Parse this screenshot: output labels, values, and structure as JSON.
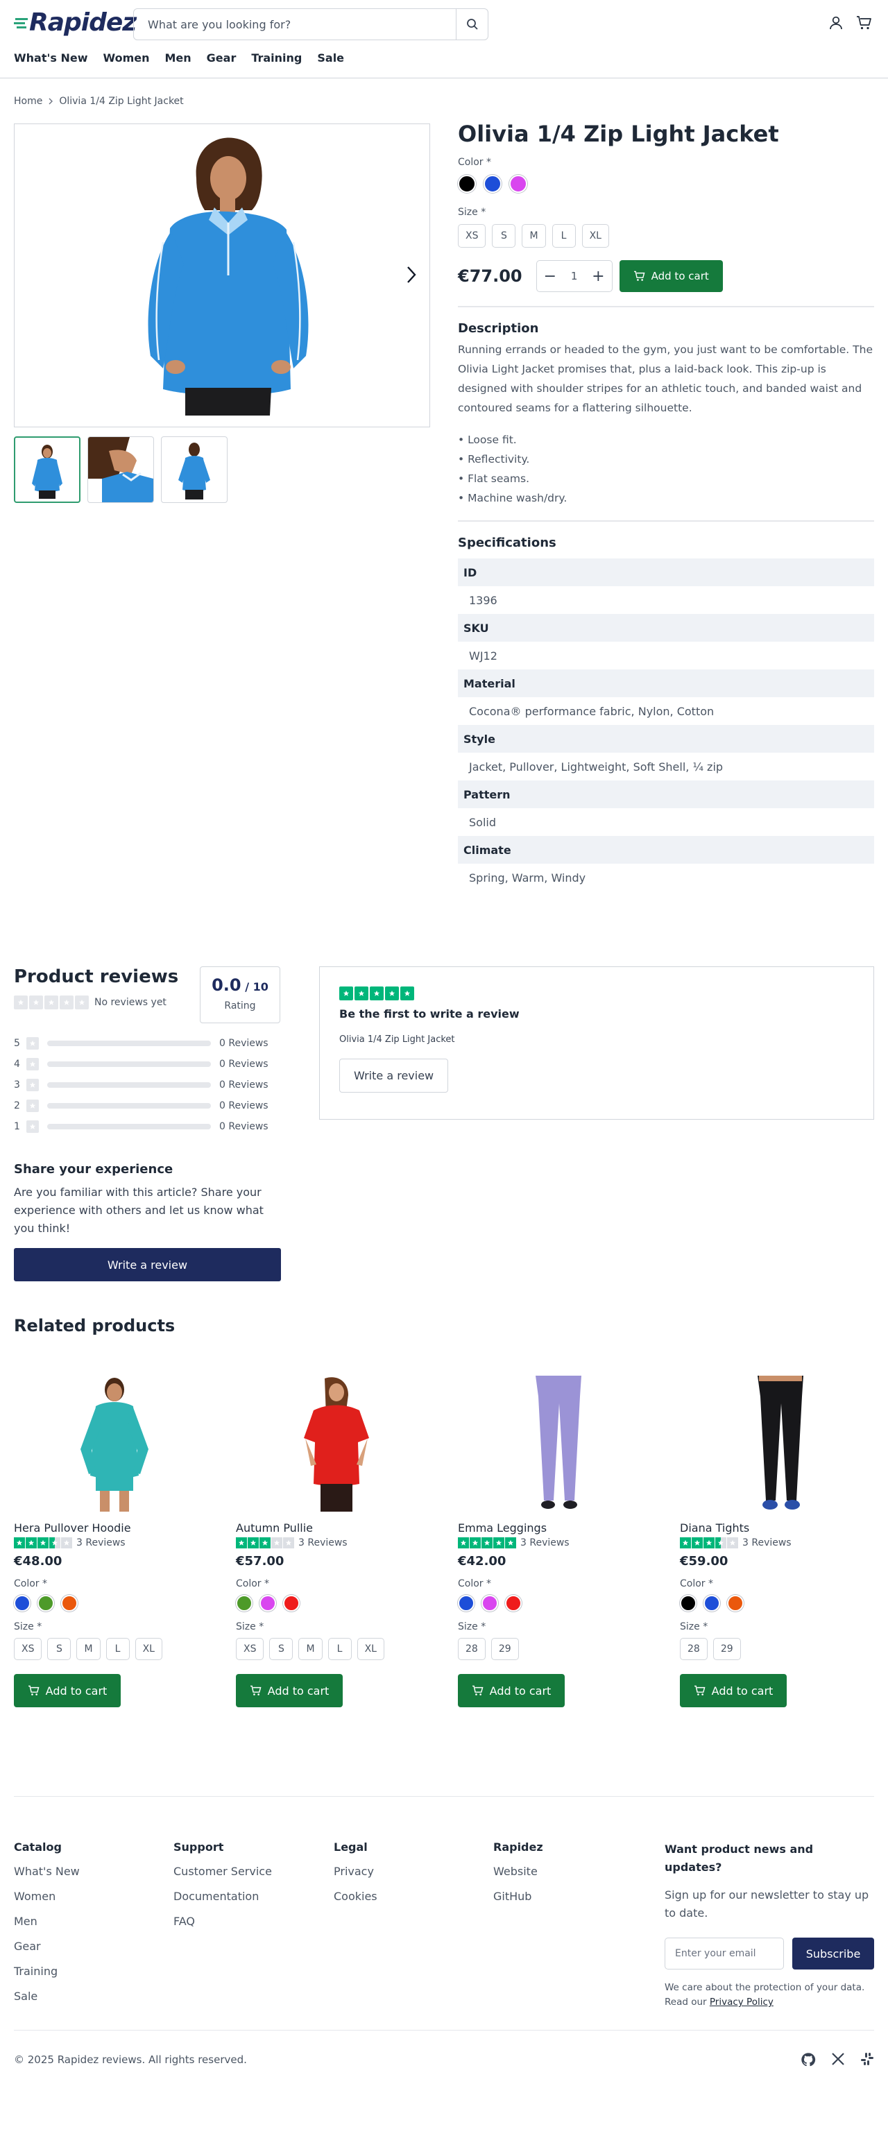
{
  "header": {
    "logo": "Rapidez",
    "search_placeholder": "What are you looking for?",
    "nav": [
      "What's New",
      "Women",
      "Men",
      "Gear",
      "Training",
      "Sale"
    ]
  },
  "breadcrumb": {
    "home": "Home",
    "current": "Olivia 1/4 Zip Light Jacket"
  },
  "product": {
    "title": "Olivia 1/4 Zip Light Jacket",
    "color_label": "Color *",
    "colors": [
      "#000000",
      "#1d4ed8",
      "#d946ef"
    ],
    "size_label": "Size *",
    "sizes": [
      "XS",
      "S",
      "M",
      "L",
      "XL"
    ],
    "price": "€77.00",
    "quantity": "1",
    "add_to_cart": "Add to cart",
    "description_title": "Description",
    "description": "Running errands or headed to the gym, you just want to be comfortable. The Olivia Light Jacket promises that, plus a laid-back look. This zip-up is designed with shoulder stripes for an athletic touch, and banded waist and contoured seams for a flattering silhouette.",
    "bullets": [
      "• Loose fit.",
      "• Reflectivity.",
      "• Flat seams.",
      "• Machine wash/dry."
    ],
    "specs_title": "Specifications",
    "specs": [
      {
        "key": "ID",
        "value": "1396"
      },
      {
        "key": "SKU",
        "value": "WJ12"
      },
      {
        "key": "Material",
        "value": "Cocona® performance fabric, Nylon, Cotton"
      },
      {
        "key": "Style",
        "value": "Jacket, Pullover, Lightweight, Soft Shell, ¼ zip"
      },
      {
        "key": "Pattern",
        "value": "Solid"
      },
      {
        "key": "Climate",
        "value": "Spring, Warm, Windy"
      }
    ]
  },
  "reviews": {
    "title": "Product reviews",
    "no_reviews": "No reviews yet",
    "score": "0.0",
    "score_suffix": " / 10",
    "rating_label": "Rating",
    "bars": [
      {
        "stars": "5",
        "label": "0 Reviews"
      },
      {
        "stars": "4",
        "label": "0 Reviews"
      },
      {
        "stars": "3",
        "label": "0 Reviews"
      },
      {
        "stars": "2",
        "label": "0 Reviews"
      },
      {
        "stars": "1",
        "label": "0 Reviews"
      }
    ],
    "first_title": "Be the first to write a review",
    "first_product": "Olivia 1/4 Zip Light Jacket",
    "write_review": "Write a review",
    "share_title": "Share your experience",
    "share_text": "Are you familiar with this article? Share your experience with others and let us know what you think!",
    "share_button": "Write a review"
  },
  "related": {
    "title": "Related products",
    "products": [
      {
        "name": "Hera Pullover Hoodie",
        "reviews": "3 Reviews",
        "rating": 3.5,
        "price": "€48.00",
        "colors": [
          "#1d4ed8",
          "#4d9a29",
          "#ea580c"
        ],
        "sizes": [
          "XS",
          "S",
          "M",
          "L",
          "XL"
        ],
        "cart": "Add to cart"
      },
      {
        "name": "Autumn Pullie",
        "reviews": "3 Reviews",
        "rating": 3,
        "price": "€57.00",
        "colors": [
          "#4d9a29",
          "#d946ef",
          "#ef1c1c"
        ],
        "sizes": [
          "XS",
          "S",
          "M",
          "L",
          "XL"
        ],
        "cart": "Add to cart"
      },
      {
        "name": "Emma Leggings",
        "reviews": "3 Reviews",
        "rating": 5,
        "price": "€42.00",
        "colors": [
          "#1d4ed8",
          "#d946ef",
          "#ef1c1c"
        ],
        "sizes": [
          "28",
          "29"
        ],
        "cart": "Add to cart"
      },
      {
        "name": "Diana Tights",
        "reviews": "3 Reviews",
        "rating": 3.5,
        "price": "€59.00",
        "colors": [
          "#000000",
          "#1d4ed8",
          "#ea580c"
        ],
        "sizes": [
          "28",
          "29"
        ],
        "cart": "Add to cart"
      }
    ]
  },
  "footer": {
    "columns": [
      {
        "title": "Catalog",
        "links": [
          "What's New",
          "Women",
          "Men",
          "Gear",
          "Training",
          "Sale"
        ]
      },
      {
        "title": "Support",
        "links": [
          "Customer Service",
          "Documentation",
          "FAQ"
        ]
      },
      {
        "title": "Legal",
        "links": [
          "Privacy",
          "Cookies"
        ]
      },
      {
        "title": "Rapidez",
        "links": [
          "Website",
          "GitHub"
        ]
      }
    ],
    "newsletter_title": "Want product news and updates?",
    "newsletter_text": "Sign up for our newsletter to stay up to date.",
    "email_placeholder": "Enter your email",
    "subscribe": "Subscribe",
    "privacy_text": "We care about the protection of your data. Read our ",
    "privacy_link": "Privacy Policy",
    "copyright": "© 2025 Rapidez reviews. All rights reserved."
  },
  "colors": {
    "brand_navy": "#1e2b5e",
    "cart_green": "#157a3c",
    "trustpilot_green": "#00b67a"
  }
}
